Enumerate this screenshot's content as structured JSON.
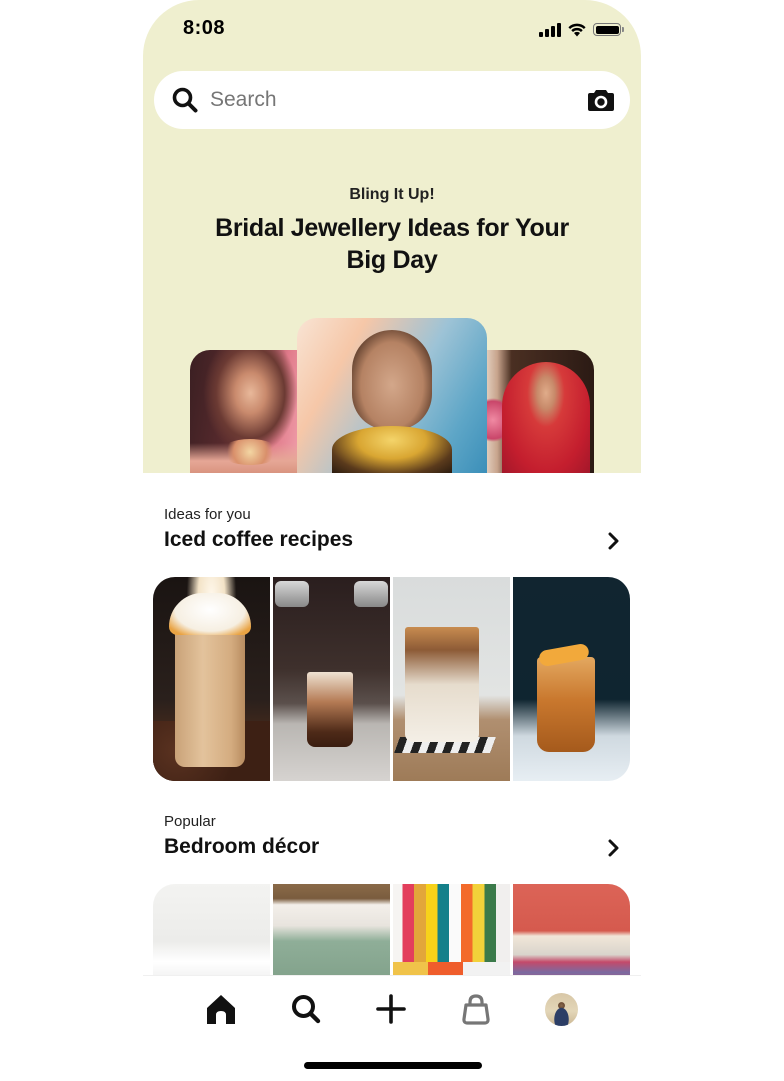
{
  "status_bar": {
    "time": "8:08",
    "icons": [
      "cellular-signal-icon",
      "wifi-icon",
      "battery-icon"
    ]
  },
  "search": {
    "placeholder": "Search",
    "value": "",
    "leading_icon": "search-icon",
    "trailing_icon": "camera-icon"
  },
  "hero": {
    "eyebrow": "Bling It Up!",
    "title": "Bridal Jewellery Ideas for Your Big Day",
    "background_color": "#efefcf",
    "carousel": {
      "images": [
        "bride-with-kundan-necklace",
        "bride-with-gold-choker-and-nath",
        "bride-in-red-saree"
      ],
      "page_count": 5,
      "active_page": 1
    }
  },
  "sections": [
    {
      "eyebrow": "Ideas for you",
      "title": "Iced coffee recipes",
      "action_icon": "chevron-right-icon",
      "images": [
        "iced-latte-with-caramel-whipped-cream",
        "milk-poured-into-iced-coffee",
        "iced-latte-on-coaster",
        "iced-tea-with-orange-slice"
      ]
    },
    {
      "eyebrow": "Popular",
      "title": "Bedroom décor",
      "action_icon": "chevron-right-icon",
      "images": [
        "white-minimal-bedroom",
        "sage-green-pillows",
        "rainbow-wood-headboard",
        "coral-wall-striped-bedding"
      ]
    }
  ],
  "tab_bar": {
    "items": [
      {
        "name": "home",
        "icon": "home-icon",
        "active": true
      },
      {
        "name": "search",
        "icon": "search-icon",
        "active": false
      },
      {
        "name": "create",
        "icon": "plus-icon",
        "active": false
      },
      {
        "name": "shop",
        "icon": "shopping-bag-icon",
        "active": false
      },
      {
        "name": "profile",
        "icon": "avatar",
        "active": false
      }
    ]
  }
}
